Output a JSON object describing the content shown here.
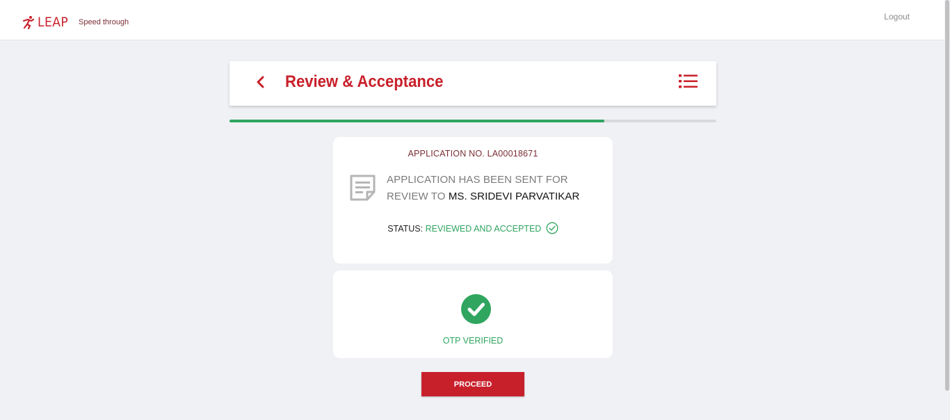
{
  "topbar": {
    "brand_name": "LEAP",
    "brand_tagline": "Speed through",
    "logout_label": "Logout"
  },
  "header": {
    "title": "Review & Acceptance"
  },
  "progress": {
    "value": 0.77
  },
  "application": {
    "number_text": "APPLICATION NO. LA00018671",
    "review_message_prefix": "APPLICATION HAS BEEN SENT FOR REVIEW TO",
    "reviewer_name": "MS. SRIDEVI PARVATIKAR",
    "status_label": "STATUS:",
    "status_value": "REVIEWED AND ACCEPTED"
  },
  "otp": {
    "label": "OTP VERIFIED"
  },
  "actions": {
    "proceed_label": "PROCEED"
  },
  "colors": {
    "brand_red": "#c8202b",
    "success_green": "#2fa55f",
    "page_background": "#f0f1f5"
  },
  "icons": {
    "brand": "runner-icon",
    "back": "chevron-left-icon",
    "menu": "list-menu-icon",
    "document": "document-icon",
    "status": "check-circle-outline-icon",
    "otp": "check-circle-filled-icon"
  }
}
